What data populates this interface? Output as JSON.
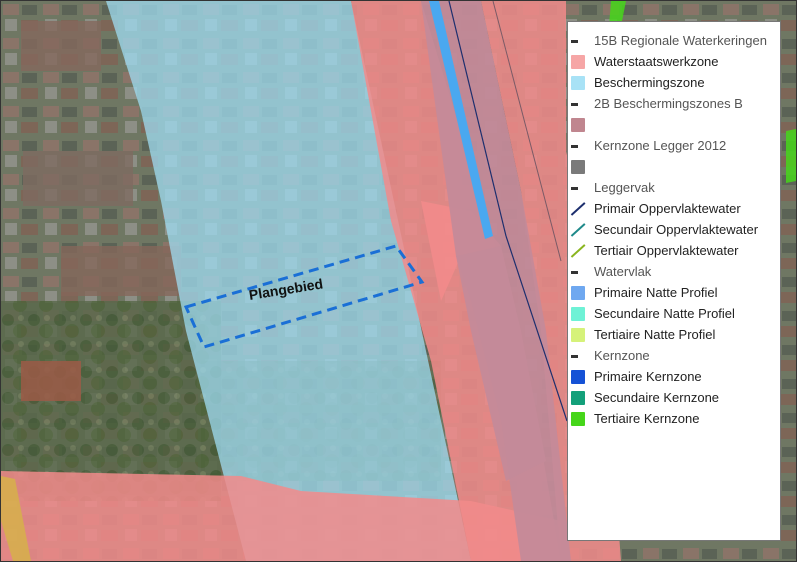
{
  "map": {
    "plangebied_label": "Plangebied",
    "colors": {
      "waterstaatswerkzone": "#f28b8b",
      "beschermingszone": "#9fdcf2",
      "beschermingszone_b": "#c48a99",
      "kernzone_legger": "#888888",
      "plangebied_outline": "#1a6fd6"
    }
  },
  "legend": {
    "rows": [
      {
        "type": "group",
        "label": "15B Regionale Waterkeringen"
      },
      {
        "type": "square",
        "label": "Waterstaatswerkzone",
        "color": "#f6a6a6"
      },
      {
        "type": "square",
        "label": "Beschermingszone",
        "color": "#a8e2f6"
      },
      {
        "type": "group",
        "label": "2B Beschermingszones B"
      },
      {
        "type": "square",
        "label": "",
        "color": "#c0868f"
      },
      {
        "type": "group",
        "label": "Kernzone Legger 2012"
      },
      {
        "type": "square",
        "label": "",
        "color": "#7a7a7a"
      },
      {
        "type": "group",
        "label": "Leggervak"
      },
      {
        "type": "line",
        "label": "Primair Oppervlaktewater",
        "color": "#1d2f6e"
      },
      {
        "type": "line",
        "label": "Secundair Oppervlaktewater",
        "color": "#1f8a8a"
      },
      {
        "type": "line",
        "label": "Tertiair Oppervlaktewater",
        "color": "#8ab51f"
      },
      {
        "type": "group",
        "label": "Watervlak"
      },
      {
        "type": "square",
        "label": "Primaire Natte Profiel",
        "color": "#6fa8f0"
      },
      {
        "type": "square",
        "label": "Secundaire Natte Profiel",
        "color": "#6ff2d6"
      },
      {
        "type": "square",
        "label": "Tertiaire Natte Profiel",
        "color": "#d6f27a"
      },
      {
        "type": "group",
        "label": "Kernzone"
      },
      {
        "type": "square",
        "label": "Primaire Kernzone",
        "color": "#1552d6"
      },
      {
        "type": "square",
        "label": "Secundaire Kernzone",
        "color": "#13a07a"
      },
      {
        "type": "square",
        "label": "Tertiaire Kernzone",
        "color": "#46d61a"
      }
    ]
  }
}
